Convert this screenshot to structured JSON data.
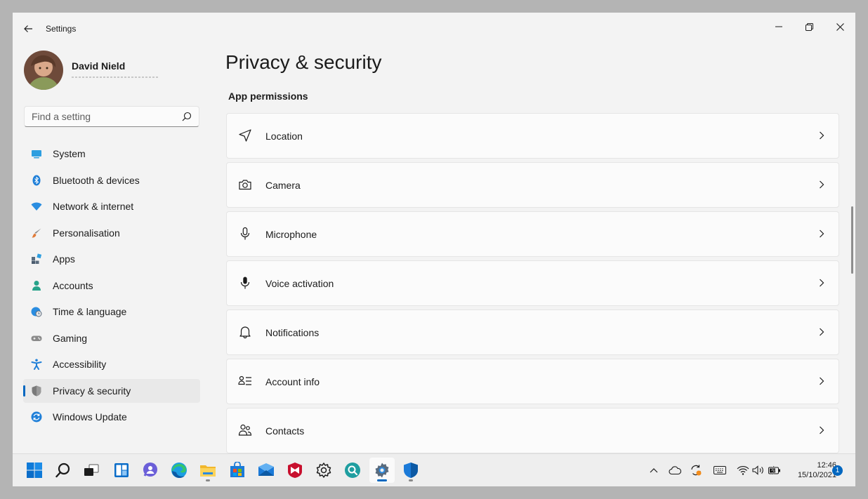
{
  "window": {
    "title": "Settings"
  },
  "user": {
    "name": "David Nield"
  },
  "search": {
    "placeholder": "Find a setting"
  },
  "sidebar": {
    "items": [
      {
        "label": "System",
        "icon": "monitor-icon",
        "color": "#2d9ee0"
      },
      {
        "label": "Bluetooth & devices",
        "icon": "bluetooth-icon",
        "color": "#1f7fd8"
      },
      {
        "label": "Network & internet",
        "icon": "wifi-icon",
        "color": "#2a8de0"
      },
      {
        "label": "Personalisation",
        "icon": "brush-icon",
        "color": "#e07b39"
      },
      {
        "label": "Apps",
        "icon": "apps-icon",
        "color": "#5a6b7d"
      },
      {
        "label": "Accounts",
        "icon": "person-icon",
        "color": "#27a38a"
      },
      {
        "label": "Time & language",
        "icon": "globe-clock-icon",
        "color": "#2a8de0"
      },
      {
        "label": "Gaming",
        "icon": "gamepad-icon",
        "color": "#8a8a8a"
      },
      {
        "label": "Accessibility",
        "icon": "accessibility-icon",
        "color": "#1f7fd8"
      },
      {
        "label": "Privacy & security",
        "icon": "shield-icon",
        "color": "#7a7a7a",
        "active": true
      },
      {
        "label": "Windows Update",
        "icon": "update-icon",
        "color": "#1f7fd8"
      }
    ]
  },
  "main": {
    "title": "Privacy & security",
    "section_title": "App permissions",
    "permissions": [
      {
        "label": "Location",
        "icon": "location-icon"
      },
      {
        "label": "Camera",
        "icon": "camera-icon"
      },
      {
        "label": "Microphone",
        "icon": "microphone-icon"
      },
      {
        "label": "Voice activation",
        "icon": "microphone-filled-icon"
      },
      {
        "label": "Notifications",
        "icon": "bell-icon"
      },
      {
        "label": "Account info",
        "icon": "account-info-icon"
      },
      {
        "label": "Contacts",
        "icon": "contacts-icon"
      }
    ]
  },
  "taskbar": {
    "apps": [
      "start-icon",
      "search-icon",
      "task-view-icon",
      "widgets-icon",
      "chat-icon",
      "edge-icon",
      "file-explorer-icon",
      "store-icon",
      "mail-icon",
      "mcafee-icon",
      "gear-app-icon",
      "quicklook-icon",
      "settings-icon",
      "defender-icon"
    ],
    "active_app": "settings-icon",
    "time": "12:46",
    "date": "15/10/2021",
    "notification_count": "1"
  },
  "colors": {
    "accent": "#0067c0",
    "window_bg": "#f3f3f3",
    "card_bg": "#fbfbfb"
  }
}
